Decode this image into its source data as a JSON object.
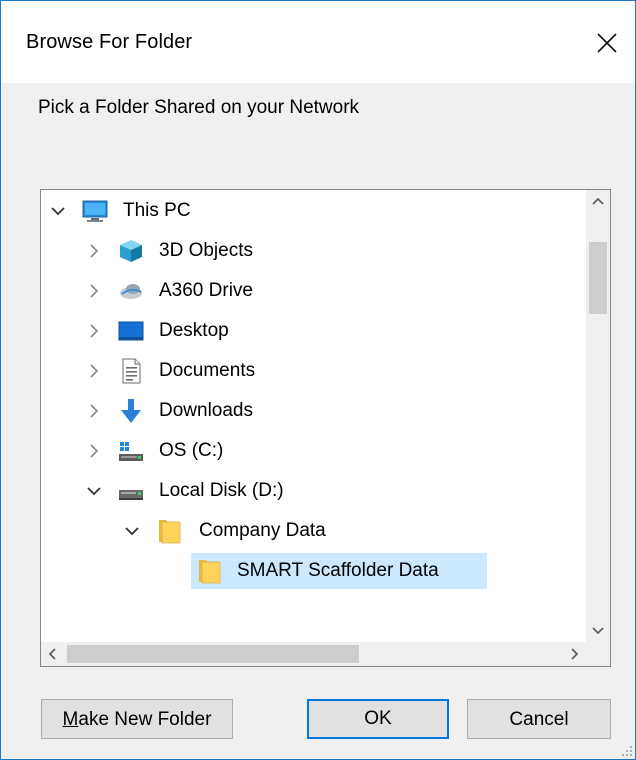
{
  "window": {
    "title": "Browse For Folder",
    "prompt": "Pick a Folder Shared on your Network"
  },
  "tree": {
    "items": [
      {
        "label": "This PC",
        "icon": "computer-icon",
        "expanded": true,
        "level": 0
      },
      {
        "label": "3D Objects",
        "icon": "3d-objects-icon",
        "expanded": false,
        "level": 1
      },
      {
        "label": "A360 Drive",
        "icon": "cloud-drive-icon",
        "expanded": false,
        "level": 1
      },
      {
        "label": "Desktop",
        "icon": "desktop-icon",
        "expanded": false,
        "level": 1
      },
      {
        "label": "Documents",
        "icon": "documents-icon",
        "expanded": false,
        "level": 1
      },
      {
        "label": "Downloads",
        "icon": "downloads-icon",
        "expanded": false,
        "level": 1
      },
      {
        "label": "OS (C:)",
        "icon": "system-drive-icon",
        "expanded": false,
        "level": 1
      },
      {
        "label": "Local Disk (D:)",
        "icon": "hard-drive-icon",
        "expanded": true,
        "level": 1
      },
      {
        "label": "Company Data",
        "icon": "folder-icon",
        "expanded": true,
        "level": 2
      },
      {
        "label": "SMART Scaffolder Data",
        "icon": "folder-icon",
        "selected": true,
        "level": 3
      }
    ]
  },
  "buttons": {
    "make_new_folder": "Make New Folder",
    "make_new_folder_mnemonic": "M",
    "make_new_folder_rest": "ake New Folder",
    "ok": "OK",
    "cancel": "Cancel"
  },
  "colors": {
    "selection": "#cce8ff",
    "accent": "#0078d7",
    "folder": "#ffd35c"
  }
}
